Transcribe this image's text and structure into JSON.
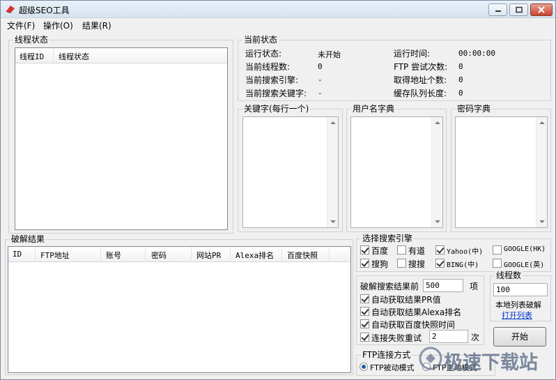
{
  "window": {
    "title": "超级SEO工具"
  },
  "menu": [
    "文件(F)",
    "操作(O)",
    "结果(R)"
  ],
  "thread_panel": {
    "group_label": "线程状态",
    "columns": [
      "线程ID",
      "线程状态"
    ]
  },
  "status_panel": {
    "group_label": "当前状态",
    "left": [
      {
        "label": "运行状态:",
        "value": "未开始"
      },
      {
        "label": "当前线程数:",
        "value": "0"
      },
      {
        "label": "当前搜索引擎:",
        "value": "-"
      },
      {
        "label": "当前搜索关键字:",
        "value": "-"
      }
    ],
    "right": [
      {
        "label": "运行时间:",
        "value": "00:00:00"
      },
      {
        "label": "FTP 尝试次数:",
        "value": "0"
      },
      {
        "label": "取得地址个数:",
        "value": "0"
      },
      {
        "label": "缓存队列长度:",
        "value": "0"
      }
    ]
  },
  "dict_panels": {
    "keywords": "关键字(每行一个)",
    "usernames": "用户名字典",
    "passwords": "密码字典"
  },
  "results_panel": {
    "group_label": "破解结果",
    "columns": [
      "ID",
      "FTP地址",
      "账号",
      "密码",
      "网站PR",
      "Alexa排名",
      "百度快照"
    ]
  },
  "engines": {
    "group_label": "选择搜索引擎",
    "items": [
      {
        "label": "百度",
        "checked": true
      },
      {
        "label": "有道",
        "checked": false
      },
      {
        "label": "Yahoo(中)",
        "checked": true
      },
      {
        "label": "GOOGLE(HK)",
        "checked": false
      },
      {
        "label": "搜狗",
        "checked": true
      },
      {
        "label": "搜搜",
        "checked": false
      },
      {
        "label": "BING(中)",
        "checked": true
      },
      {
        "label": "GOOGLE(英)",
        "checked": false
      }
    ]
  },
  "options": {
    "results_before_label": "破解搜索结果前",
    "results_before_value": "500",
    "results_before_unit": "项",
    "auto_pr": "自动获取结果PR值",
    "auto_alexa": "自动获取结果Alexa排名",
    "auto_baidu": "自动获取百度快照时间",
    "retry_label": "连接失败重试",
    "retry_value": "2",
    "retry_unit": "次"
  },
  "threads": {
    "label": "线程数",
    "value": "100",
    "local_label": "本地列表破解",
    "open_list": "打开列表"
  },
  "start_button": "开始",
  "ftp_mode": {
    "group_label": "FTP连接方式",
    "passive": "FTP被动模式",
    "active": "FTP主动模式"
  },
  "watermark": "极速下载站"
}
